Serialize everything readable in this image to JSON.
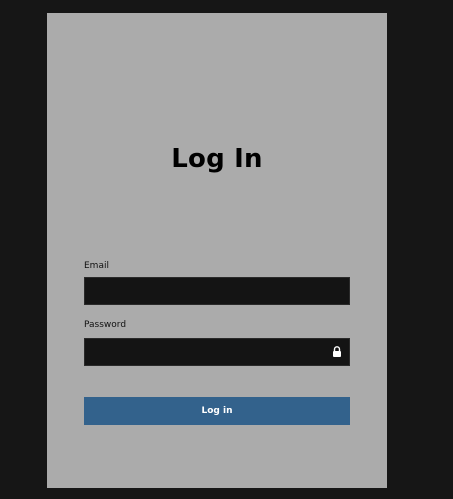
{
  "form": {
    "title": "Log In",
    "email_label": "Email",
    "email_value": "",
    "password_label": "Password",
    "password_value": "",
    "submit_label": "Log in"
  },
  "icons": {
    "password_field": "lock-icon"
  },
  "colors": {
    "page_background": "#161616",
    "card_background": "#ababab",
    "input_background": "#141414",
    "button_background": "#33628c"
  }
}
